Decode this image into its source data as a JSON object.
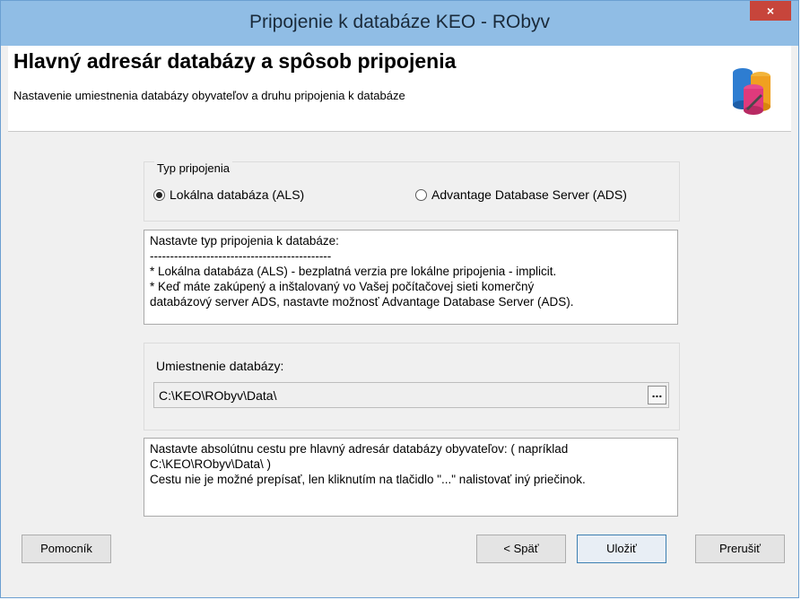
{
  "window": {
    "title": "Pripojenie k databáze KEO - RObyv",
    "close_label": "×"
  },
  "header": {
    "title": "Hlavný adresár databázy a spôsob pripojenia",
    "subtitle": "Nastavenie umiestnenia databázy obyvateľov a druhu pripojenia k databáze",
    "icon": "database-icon"
  },
  "connection": {
    "legend": "Typ pripojenia",
    "options": [
      {
        "label": "Lokálna databáza (ALS)",
        "selected": true
      },
      {
        "label": "Advantage Database Server (ADS)",
        "selected": false
      }
    ]
  },
  "note1": {
    "lines": [
      "Nastavte typ pripojenia k databáze:",
      "---------------------------------------------",
      "* Lokálna databáza (ALS) - bezplatná verzia pre lokálne pripojenia - implicit.",
      "* Keď máte zakúpený a inštalovaný vo Vašej počítačovej sieti komerčný",
      "databázový server ADS, nastavte možnosť Advantage Database Server (ADS)."
    ]
  },
  "location": {
    "label": "Umiestnenie databázy:",
    "value": "C:\\KEO\\RObyv\\Data\\",
    "browse_label": "..."
  },
  "note2": {
    "lines": [
      "Nastavte absolútnu cestu pre hlavný adresár databázy obyvateľov: ( napríklad",
      "C:\\KEO\\RObyv\\Data\\ )",
      "Cestu nie je možné prepísať, len kliknutím na tlačidlo \"...\" nalistovať iný priečinok."
    ]
  },
  "buttons": {
    "help": "Pomocník",
    "back": "< Späť",
    "save": "Uložiť",
    "cancel": "Prerušiť"
  },
  "colors": {
    "titlebar": "#90bde5",
    "close": "#c7453b",
    "default_button_border": "#3c7fb1"
  }
}
